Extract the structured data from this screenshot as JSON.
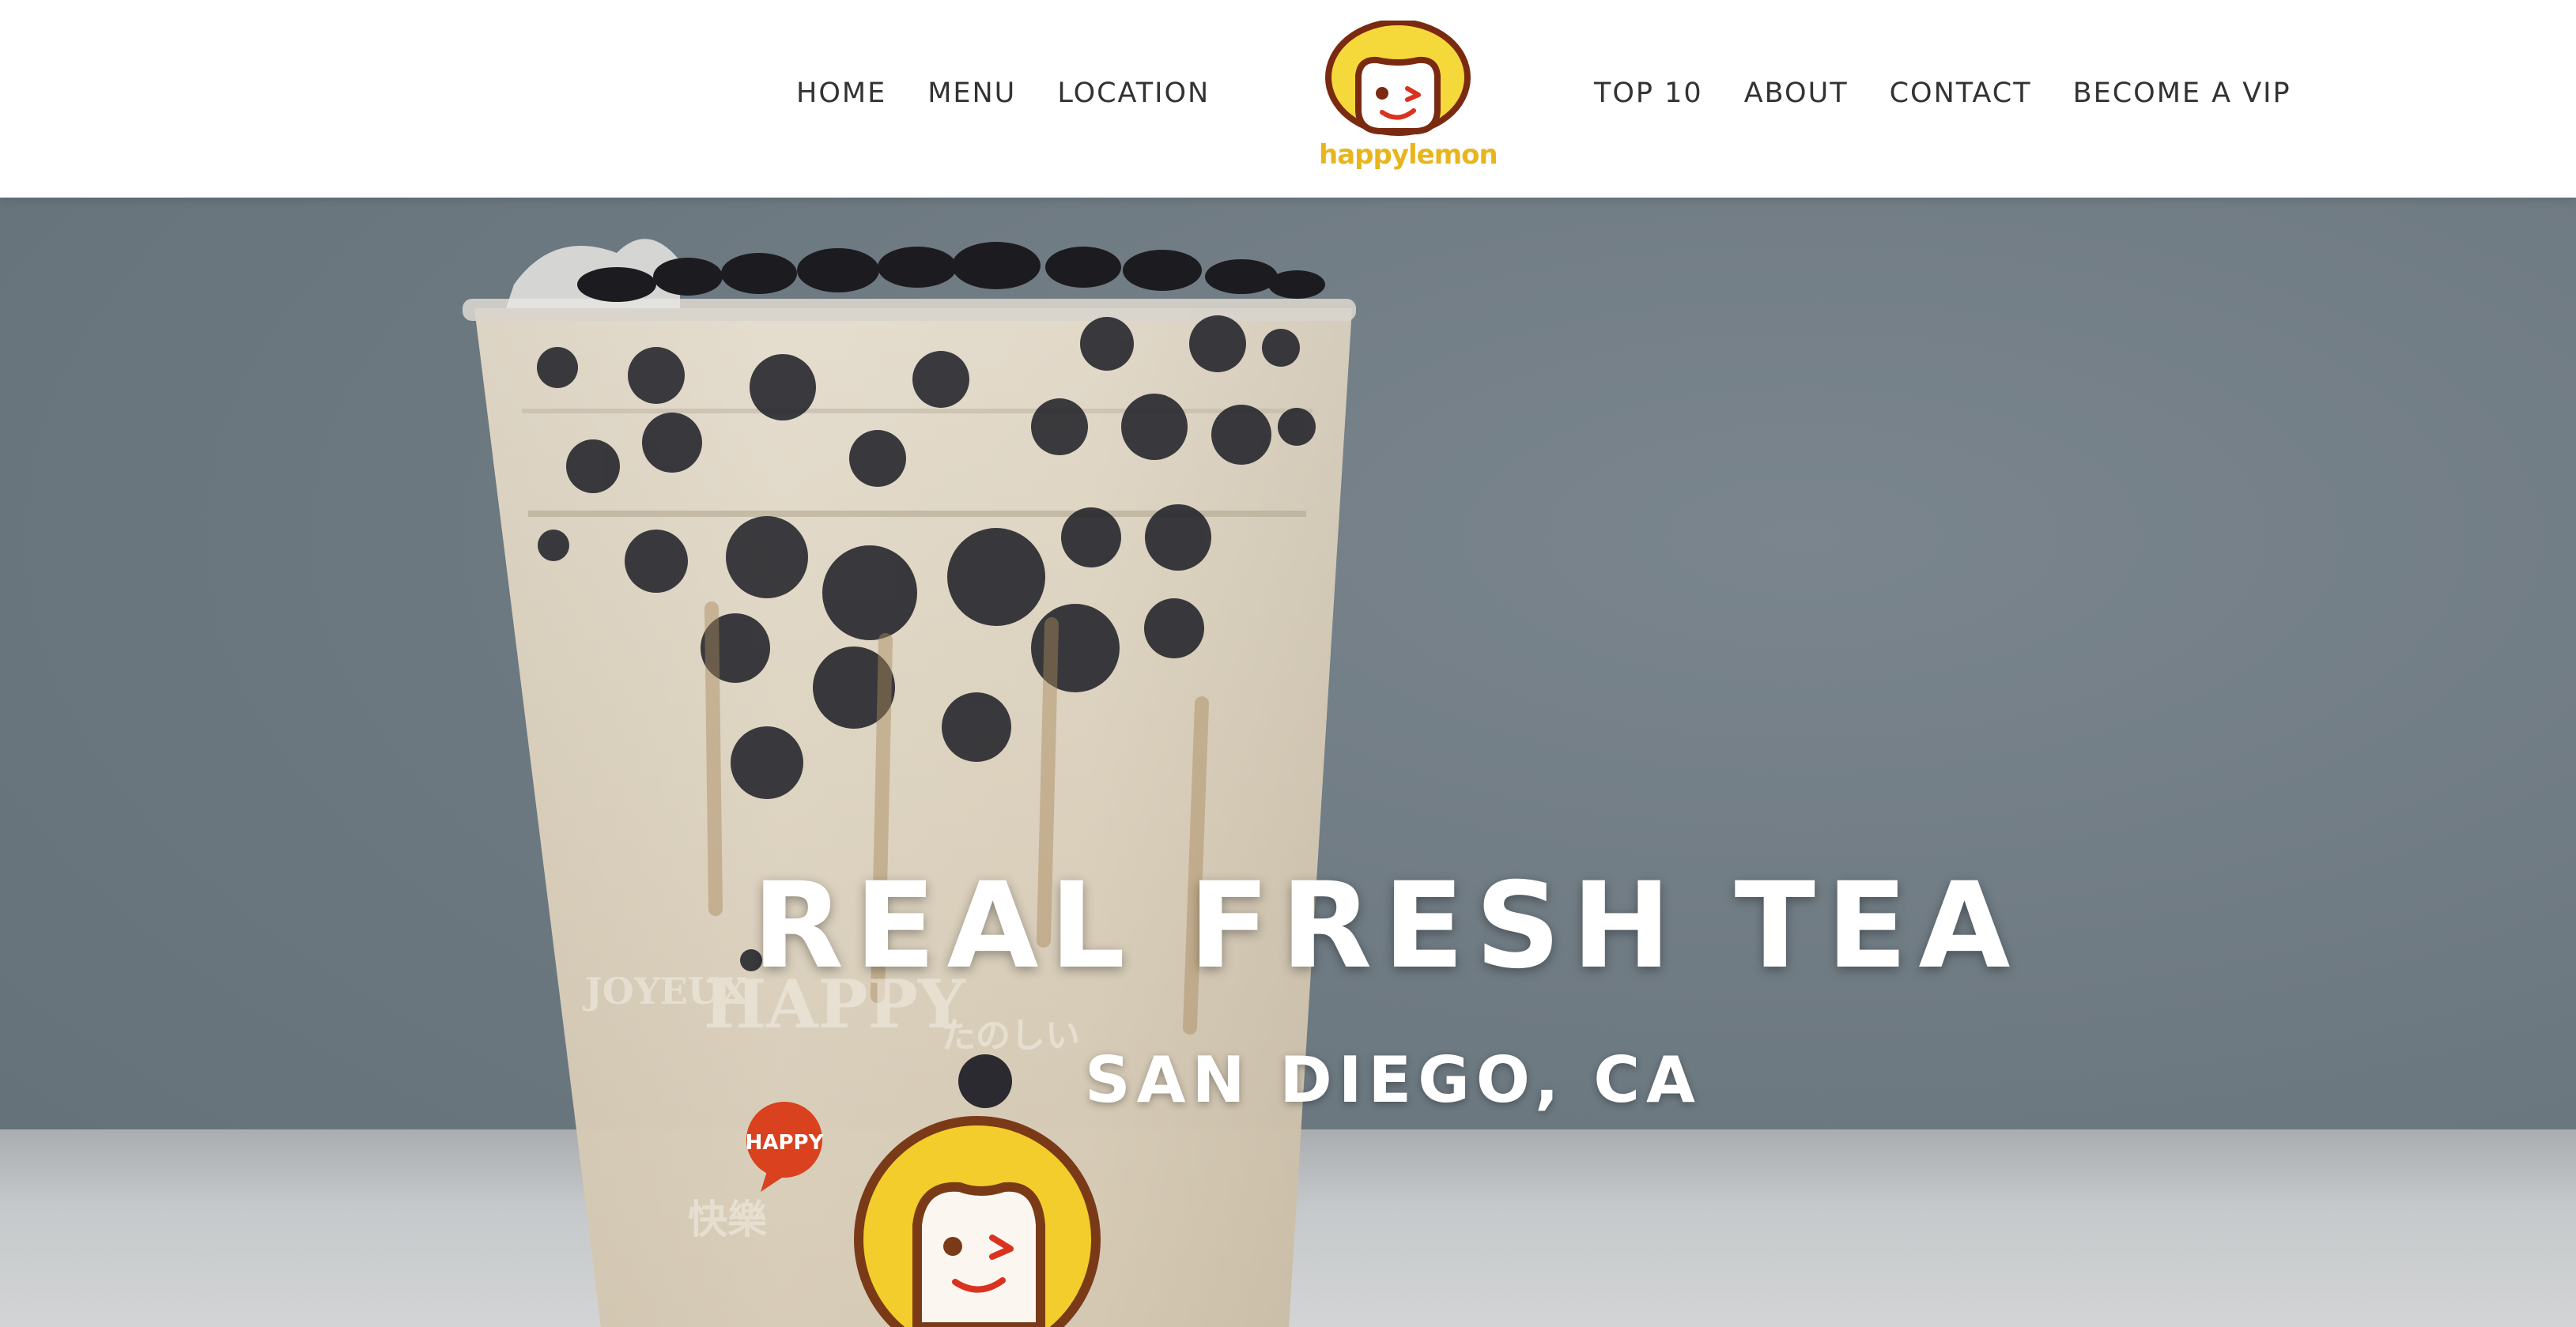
{
  "header": {
    "nav_left": [
      {
        "label": "HOME"
      },
      {
        "label": "MENU"
      },
      {
        "label": "LOCATION"
      }
    ],
    "logo": {
      "text": "happylemon",
      "icon": "happy-lemon-mascot"
    },
    "nav_right": [
      {
        "label": "TOP 10"
      },
      {
        "label": "ABOUT"
      },
      {
        "label": "CONTACT"
      },
      {
        "label": "BECOME A VIP"
      }
    ]
  },
  "hero": {
    "title": "REAL FRESH TEA",
    "subtitle": "SAN DIEGO, CA",
    "cup_print": {
      "badge": "HAPPY",
      "words": [
        "HAPPY",
        "JOYEUX",
        "たのしい",
        "快樂"
      ]
    }
  },
  "colors": {
    "brand_yellow": "#f5d83a",
    "brand_brown": "#7a2a10",
    "logo_text": "#e8b51e",
    "nav_text": "#333333",
    "hero_bg": "#6f7b84"
  }
}
